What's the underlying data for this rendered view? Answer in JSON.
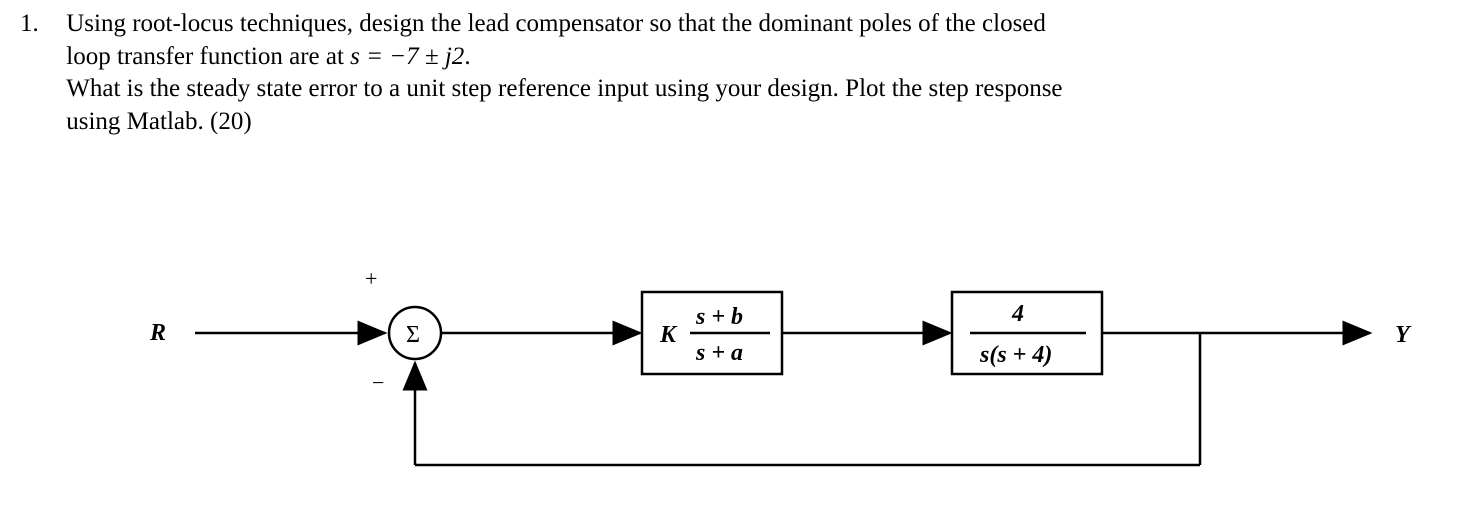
{
  "question": {
    "number": "1.",
    "line1_a": "Using root-locus techniques, design the lead compensator so that the dominant poles of the closed",
    "line2_a": "loop transfer function are at ",
    "line2_eq": "s = −7 ± j2",
    "line2_b": ".",
    "line3": "What is the steady state error to a unit step reference input using your design.  Plot the step response",
    "line4": "using Matlab.  (20)"
  },
  "diagram": {
    "input_label": "R",
    "output_label": "Y",
    "sum_symbol": "Σ",
    "plus": "+",
    "minus": "−",
    "comp_K": "K",
    "comp_num": "s + b",
    "comp_den": "s + a",
    "plant_num": "4",
    "plant_den": "s(s + 4)"
  }
}
